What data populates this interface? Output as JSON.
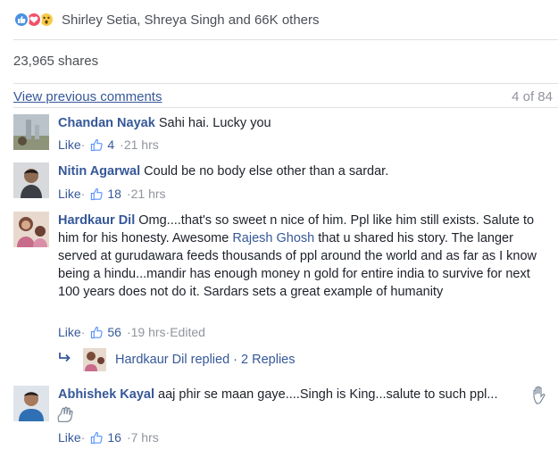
{
  "reactions": {
    "icons": [
      "like-icon",
      "love-icon",
      "wow-icon"
    ],
    "text": "Shirley Setia, Shreya Singh and 66K others"
  },
  "shares": "23,965 shares",
  "comments_header": {
    "view_previous": "View previous comments",
    "count": "4 of 84"
  },
  "comments": [
    {
      "name": "Chandan Nayak",
      "text": "Sahi hai. Lucky you",
      "like_label": "Like",
      "sep": " · ",
      "likes": "4",
      "time": "21 hrs"
    },
    {
      "name": "Nitin Agarwal",
      "text": "Could be no body else other than a sardar.",
      "like_label": "Like",
      "sep": " · ",
      "likes": "18",
      "time": "21 hrs"
    },
    {
      "name": "Hardkaur Dil",
      "text_before": "Omg....that's so sweet n nice of him. Ppl like him still exists. Salute to him for his honesty. Awesome",
      "mention": "Rajesh Ghosh",
      "text_after": "that u shared his story. The langer served at gurudawara feeds thousands of ppl around the world and as far as I know being a hindu...mandir has enough money n gold for entire india to survive for next 100 years does not do it. Sardars sets a great example of humanity",
      "like_label": "Like",
      "sep": " · ",
      "likes": "56",
      "time": "19 hrs",
      "edited": "Edited",
      "replies": {
        "name": "Hardkaur Dil",
        "replied": "replied",
        "count": "2 Replies"
      }
    },
    {
      "name": "Abhishek Kayal",
      "text": "aaj phir se maan gaye....Singh is King...salute to such ppl...",
      "like_label": "Like",
      "sep": " · ",
      "likes": "16",
      "time": "7 hrs"
    }
  ]
}
